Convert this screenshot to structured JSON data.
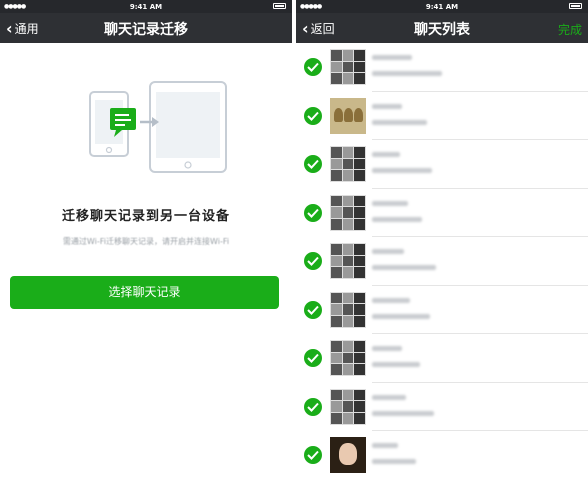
{
  "left": {
    "status": {
      "time": "9:41 AM"
    },
    "nav": {
      "back_label": "通用",
      "title": "聊天记录迁移"
    },
    "heading": "迁移聊天记录到另一台设备",
    "subtext": "需通过Wi-Fi迁移聊天记录，请开启并连接Wi-Fi",
    "button_label": "选择聊天记录",
    "colors": {
      "accent": "#1aad19",
      "navbar": "#2e3034"
    }
  },
  "right": {
    "status": {
      "time": "9:41 AM"
    },
    "nav": {
      "back_label": "返回",
      "title": "聊天列表",
      "done_label": "完成"
    },
    "rows": [
      {
        "selected": true,
        "avatar": "group"
      },
      {
        "selected": true,
        "avatar": "warm"
      },
      {
        "selected": true,
        "avatar": "group"
      },
      {
        "selected": true,
        "avatar": "group"
      },
      {
        "selected": true,
        "avatar": "group"
      },
      {
        "selected": true,
        "avatar": "group"
      },
      {
        "selected": true,
        "avatar": "group"
      },
      {
        "selected": true,
        "avatar": "group"
      },
      {
        "selected": true,
        "avatar": "single"
      }
    ]
  }
}
